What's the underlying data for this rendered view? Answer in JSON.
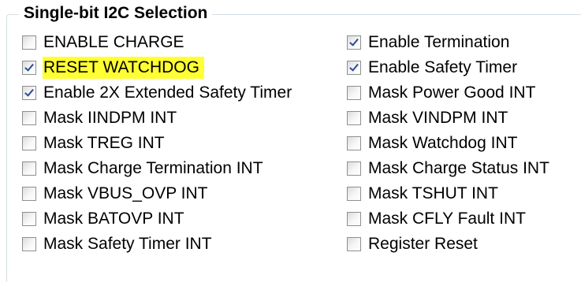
{
  "group": {
    "title": "Single-bit I2C Selection"
  },
  "left_column": [
    {
      "label": "ENABLE CHARGE",
      "checked": false,
      "highlighted": false
    },
    {
      "label": "RESET WATCHDOG",
      "checked": true,
      "highlighted": true
    },
    {
      "label": "Enable 2X Extended Safety Timer",
      "checked": true,
      "highlighted": false
    },
    {
      "label": "Mask IINDPM INT",
      "checked": false,
      "highlighted": false
    },
    {
      "label": "Mask TREG INT",
      "checked": false,
      "highlighted": false
    },
    {
      "label": "Mask Charge Termination INT",
      "checked": false,
      "highlighted": false
    },
    {
      "label": "Mask VBUS_OVP INT",
      "checked": false,
      "highlighted": false
    },
    {
      "label": "Mask BATOVP INT",
      "checked": false,
      "highlighted": false
    },
    {
      "label": "Mask Safety Timer INT",
      "checked": false,
      "highlighted": false
    }
  ],
  "right_column": [
    {
      "label": "Enable Termination",
      "checked": true,
      "highlighted": false
    },
    {
      "label": "Enable Safety Timer",
      "checked": true,
      "highlighted": false
    },
    {
      "label": "Mask Power Good INT",
      "checked": false,
      "highlighted": false
    },
    {
      "label": "Mask VINDPM INT",
      "checked": false,
      "highlighted": false
    },
    {
      "label": "Mask Watchdog INT",
      "checked": false,
      "highlighted": false
    },
    {
      "label": "Mask Charge Status INT",
      "checked": false,
      "highlighted": false
    },
    {
      "label": "Mask TSHUT INT",
      "checked": false,
      "highlighted": false
    },
    {
      "label": "Mask CFLY Fault INT",
      "checked": false,
      "highlighted": false
    },
    {
      "label": "Register Reset",
      "checked": false,
      "highlighted": false
    }
  ],
  "colors": {
    "highlight": "#ffff33",
    "check_mark": "#2b4c9a",
    "group_border": "#d5dfe5"
  }
}
